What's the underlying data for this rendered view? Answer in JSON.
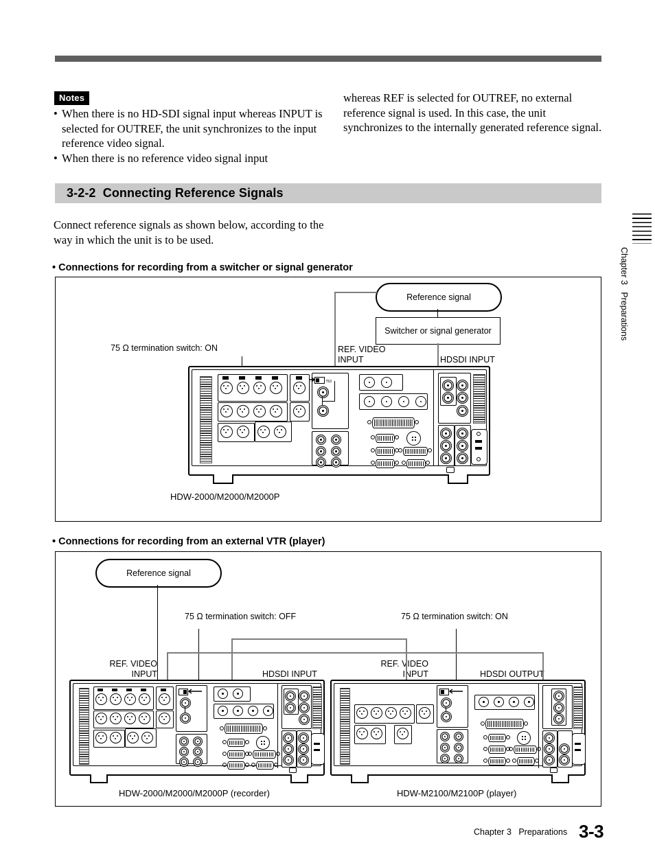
{
  "page": {
    "footer_chapter": "Chapter 3   Preparations",
    "footer_page": "3-3",
    "side_tab": "Chapter 3   Preparations"
  },
  "notes": {
    "tag": "Notes",
    "items": [
      "When there is no HD-SDI signal input whereas INPUT is selected for OUTREF, the unit synchronizes to the input reference video signal.",
      "When there is no reference video signal input"
    ],
    "continuation": "whereas REF is selected for OUTREF, no external reference signal is used. In this case, the unit synchronizes to the internally generated reference signal."
  },
  "section": {
    "number": "3-2-2",
    "title": "Connecting Reference Signals",
    "heading": "3-2-2  Connecting Reference Signals",
    "intro": "Connect reference signals as shown below, according to the way in which the unit is to be used.",
    "bar_color": "#c9c9c9"
  },
  "diagram1": {
    "subheading": "• Connections for recording from a switcher or signal generator",
    "pill_reference_signal": "Reference signal",
    "box_switcher": "Switcher or signal generator",
    "label_termination": "75 Ω termination switch: ON",
    "label_ref_video_input": "REF. VIDEO\nINPUT",
    "label_hdsdi_input": "HDSDI INPUT",
    "caption": "HDW-2000/M2000/M2000P"
  },
  "diagram2": {
    "subheading": "• Connections for recording from an external VTR (player)",
    "pill_reference_signal": "Reference signal",
    "label_termination_off": "75 Ω termination switch: OFF",
    "label_termination_on": "75 Ω termination switch: ON",
    "label_ref_video_input_left": "REF. VIDEO\nINPUT",
    "label_hdsdi_input": "HDSDI INPUT",
    "label_ref_video_input_right": "REF. VIDEO\nINPUT",
    "label_hdsdi_output": "HDSDI OUTPUT",
    "caption_recorder": "HDW-2000/M2000/M2000P (recorder)",
    "caption_player": "HDW-M2100/M2100P (player)"
  },
  "colors": {
    "rule": "#5f5f5f",
    "section_bar": "#c9c9c9",
    "cable": "#7d7d7d",
    "ink": "#000000"
  }
}
